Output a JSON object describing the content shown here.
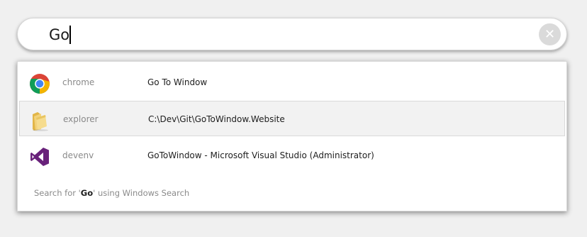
{
  "search": {
    "query": "Go",
    "clear_icon": "close-icon"
  },
  "results": [
    {
      "process": "chrome",
      "title": "Go To Window",
      "icon": "chrome-icon",
      "selected": false
    },
    {
      "process": "explorer",
      "title": "C:\\Dev\\Git\\GoToWindow.Website",
      "icon": "folder-icon",
      "selected": true
    },
    {
      "process": "devenv",
      "title": "GoToWindow - Microsoft Visual Studio (Administrator)",
      "icon": "visual-studio-icon",
      "selected": false
    }
  ],
  "windows_search": {
    "prefix": "Search for '",
    "term": "Go",
    "suffix": "' using Windows Search"
  },
  "colors": {
    "background": "#f0f0f0",
    "selected_row": "#f2f2f2",
    "vs_purple": "#68217a",
    "clear_button": "#dadada"
  }
}
